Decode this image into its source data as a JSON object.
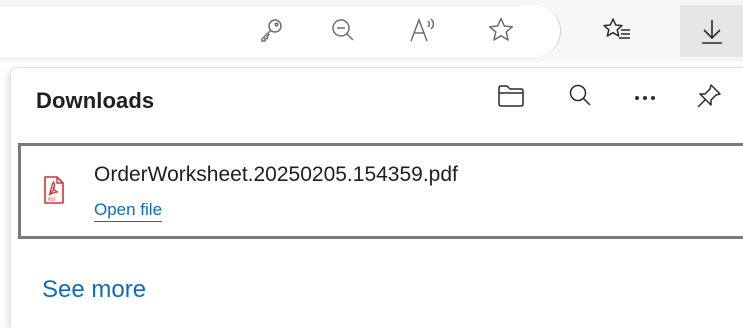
{
  "toolbar": {
    "icons": [
      "key-icon",
      "zoom-out-icon",
      "read-aloud-icon",
      "favorite-star-icon",
      "favorites-list-icon",
      "download-icon"
    ]
  },
  "downloads": {
    "title": "Downloads",
    "header_icons": [
      "open-folder-icon",
      "search-icon",
      "more-icon",
      "pin-icon"
    ],
    "items": [
      {
        "file_name": "OrderWorksheet.20250205.154359.pdf",
        "action": "Open file",
        "file_type_icon": "pdf-icon"
      }
    ],
    "see_more": "See more"
  },
  "colors": {
    "link": "#0f6cbd",
    "pdf_red": "#d13438",
    "selection_border": "#7a7a7a"
  }
}
